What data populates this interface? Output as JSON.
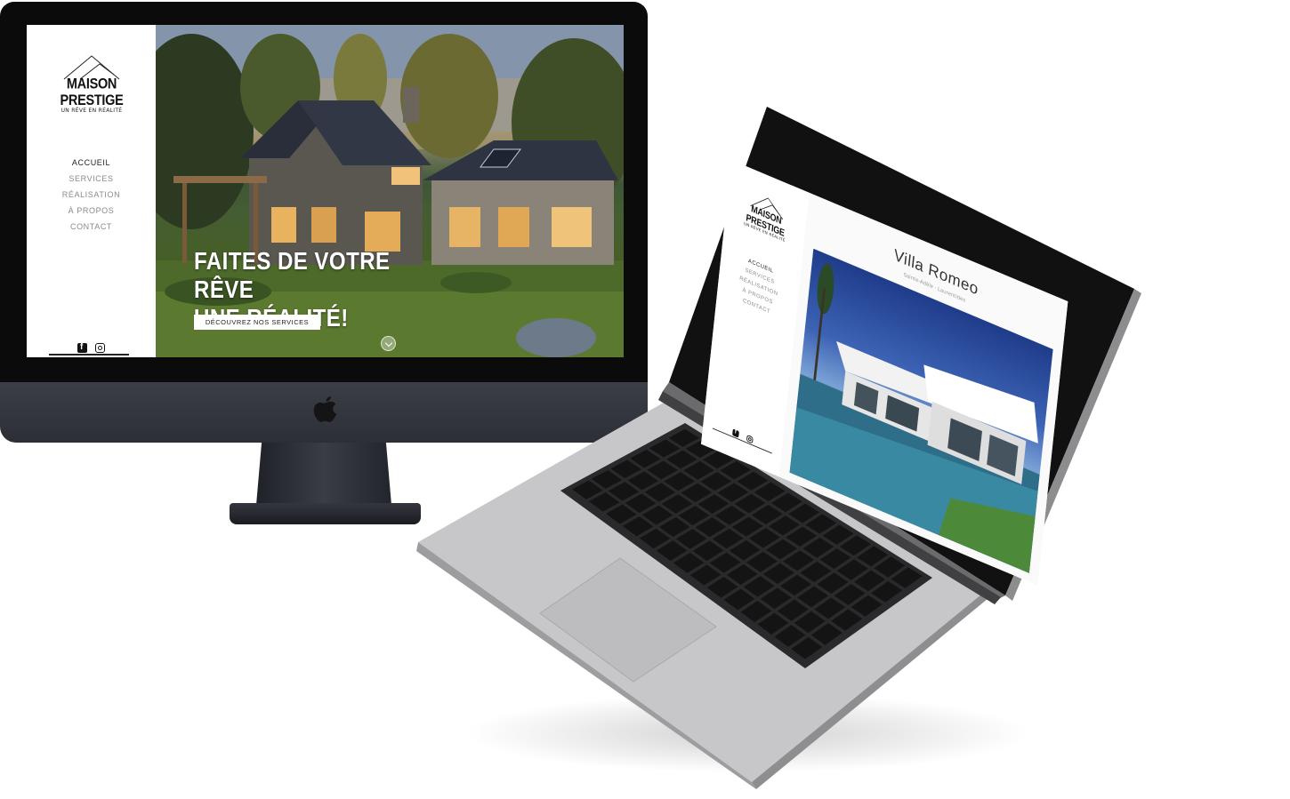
{
  "desktop": {
    "logo": {
      "title": "MAISON PRESTIGE",
      "tagline": "UN RÊVE EN RÉALITÉ"
    },
    "nav": [
      {
        "label": "ACCUEIL",
        "active": true
      },
      {
        "label": "SERVICES",
        "active": false
      },
      {
        "label": "RÉALISATION",
        "active": false
      },
      {
        "label": "À PROPOS",
        "active": false
      },
      {
        "label": "CONTACT",
        "active": false
      }
    ],
    "hero": {
      "title_line1": "FAITES DE VOTRE RÊVE",
      "title_line2": "UNE RÉALITÉ!",
      "button": "DÉCOUVREZ NOS SERVICES"
    },
    "social": [
      "facebook-icon",
      "instagram-icon"
    ]
  },
  "laptop": {
    "logo": {
      "title": "MAISON PRESTIGE",
      "tagline": "UN RÊVE EN RÉALITÉ"
    },
    "nav": [
      {
        "label": "ACCUEIL",
        "active": true
      },
      {
        "label": "SERVICES",
        "active": false
      },
      {
        "label": "RÉALISATION",
        "active": false
      },
      {
        "label": "À PROPOS",
        "active": false
      },
      {
        "label": "CONTACT",
        "active": false
      }
    ],
    "project": {
      "title": "Villa Romeo",
      "location": "Sainte-Adèle · Laurentides"
    }
  },
  "colors": {
    "imac_body": "#2d2f37",
    "bezel": "#0b0b0c",
    "laptop_aluminium": "#c9c9cb",
    "keys": "#141414",
    "accent_text": "#ffffff"
  }
}
